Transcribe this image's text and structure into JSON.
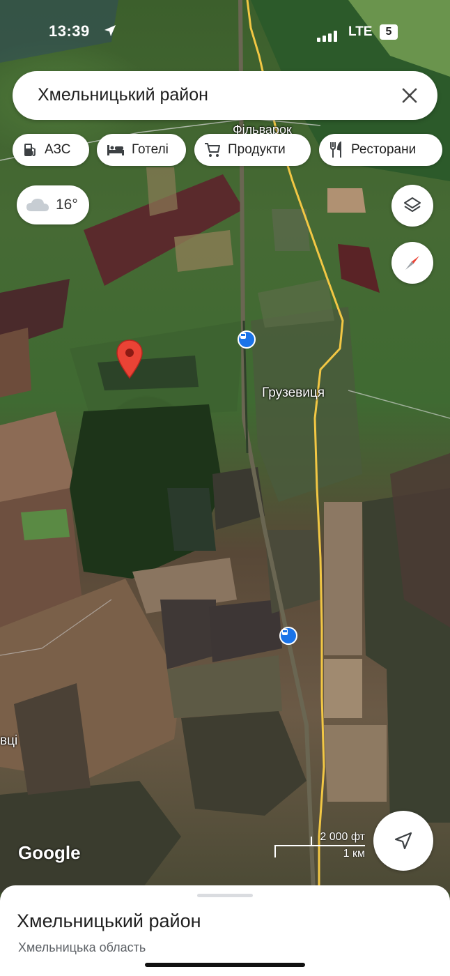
{
  "status_bar": {
    "time": "13:39",
    "network": "LTE",
    "battery": "5"
  },
  "search": {
    "query": "Хмельницький район"
  },
  "chips": [
    {
      "label": "АЗС",
      "icon": "gas-station-icon"
    },
    {
      "label": "Готелі",
      "icon": "hotel-bed-icon"
    },
    {
      "label": "Продукти",
      "icon": "shopping-cart-icon"
    },
    {
      "label": "Ресторани",
      "icon": "restaurant-icon"
    }
  ],
  "weather": {
    "temp": "16°",
    "icon": "cloud-icon"
  },
  "map": {
    "labels": {
      "filvarok": "Фільварок",
      "gruzevytsia": "Грузевиця",
      "partial_village": "вці"
    },
    "google_logo": "Google",
    "scale": {
      "feet": "2 000 фт",
      "km": "1 км"
    }
  },
  "place": {
    "title": "Хмельницький район",
    "subtitle": "Хмельницька область"
  },
  "colors": {
    "pin": "#ea4335",
    "transit": "#1a73e8",
    "compass_red": "#ea4335"
  }
}
